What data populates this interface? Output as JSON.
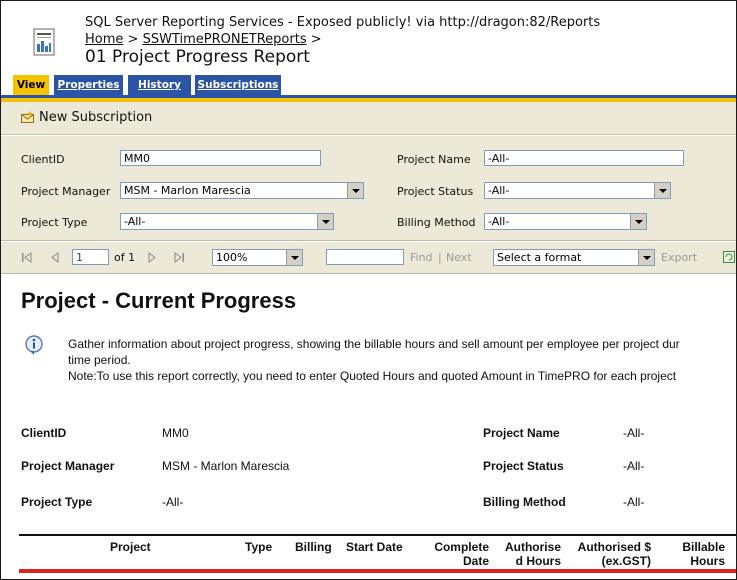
{
  "header": {
    "site_line": "SQL Server Reporting Services - Exposed publicly! via http://dragon:82/Reports",
    "breadcrumb_home": "Home",
    "breadcrumb_sep1": " > ",
    "breadcrumb_folder": "SSWTimePRONETReports",
    "breadcrumb_sep2": " >",
    "report_name": "01 Project Progress Report"
  },
  "tabs": [
    "View",
    "Properties",
    "History",
    "Subscriptions"
  ],
  "actions": {
    "new_subscription": "New Subscription"
  },
  "params": {
    "client_id": {
      "label": "ClientID",
      "value": "MM0"
    },
    "project_name": {
      "label": "Project Name",
      "value": "-All-"
    },
    "project_manager": {
      "label": "Project Manager",
      "value": "MSM - Marlon Marescia"
    },
    "project_status": {
      "label": "Project Status",
      "value": "-All-"
    },
    "project_type": {
      "label": "Project Type",
      "value": "-All-"
    },
    "billing_method": {
      "label": "Billing Method",
      "value": "-All-"
    }
  },
  "toolbar": {
    "page_value": "1",
    "of_label": "of 1",
    "zoom": "100%",
    "find_value": "",
    "find": "Find",
    "sep": "|",
    "next": "Next",
    "format": "Select a format",
    "export": "Export"
  },
  "report": {
    "title": "Project - Current Progress",
    "desc_line1": "Gather information about project progress, showing the billable hours and sell amount per employee per project dur",
    "desc_line2": "time period.",
    "desc_line3": "Note:To use this report correctly, you need to enter Quoted Hours and quoted Amount in TimePRO for each project",
    "summary": {
      "client_id_label": "ClientID",
      "client_id_value": "MM0",
      "project_name_label": "Project Name",
      "project_name_value": "-All-",
      "project_manager_label": "Project Manager",
      "project_manager_value": "MSM - Marlon Marescia",
      "project_status_label": "Project Status",
      "project_status_value": "-All-",
      "project_type_label": "Project Type",
      "project_type_value": "-All-",
      "billing_method_label": "Billing Method",
      "billing_method_value": "-All-"
    },
    "columns": {
      "project": "Project",
      "type": "Type",
      "billing": "Billing",
      "start_date": "Start Date",
      "complete_date_1": "Complete",
      "complete_date_2": "Date",
      "authorised_hours_1": "Authorise",
      "authorised_hours_2": "d Hours",
      "authorised_amount_1": "Authorised $",
      "authorised_amount_2": "(ex.GST)",
      "billable_hours_1": "Billable",
      "billable_hours_2": "Hours"
    }
  },
  "colors": {
    "tab_blue": "#2b54a4",
    "tab_gold": "#f5c200",
    "chrome": "#ece9d8",
    "table_red": "#d22222"
  }
}
